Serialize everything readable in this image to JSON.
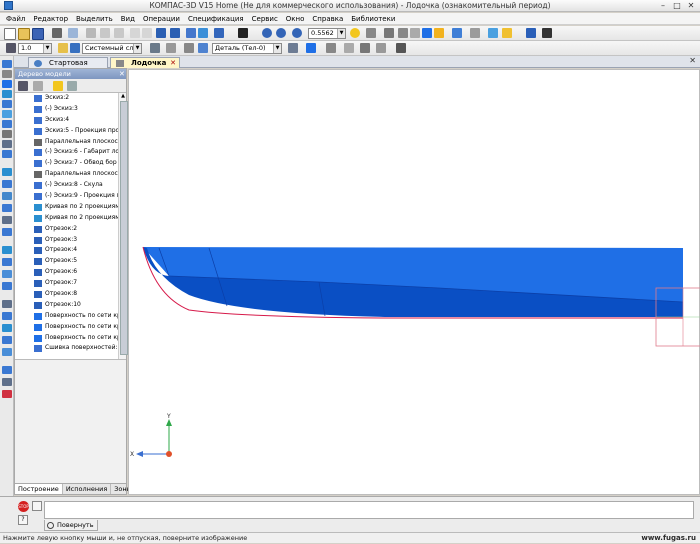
{
  "window": {
    "title": "КОМПАС-3D V15 Home (Не для коммерческого использования) - Лодочка (ознакомительный период)"
  },
  "menu": [
    "Файл",
    "Редактор",
    "Выделить",
    "Вид",
    "Операции",
    "Спецификация",
    "Сервис",
    "Окно",
    "Справка",
    "Библиотеки"
  ],
  "toolbar": {
    "zoom_value": "0.5562",
    "line_width": "1.0",
    "layer": "Системный слой (0)",
    "detail": "Деталь (Тел-0)"
  },
  "tabs": [
    {
      "label": "Стартовая страница",
      "active": false
    },
    {
      "label": "Лодочка",
      "active": true
    }
  ],
  "tree": {
    "header": "Дерево модели",
    "items": [
      {
        "label": "Эскиз:2",
        "icon": "sketch"
      },
      {
        "label": "(-) Эскиз:3",
        "icon": "sketch"
      },
      {
        "label": "Эскиз:4",
        "icon": "sketch"
      },
      {
        "label": "Эскиз:5 - Проекция про",
        "icon": "sketch"
      },
      {
        "label": "Параллельная плоскост",
        "icon": "plane"
      },
      {
        "label": "(-) Эскиз:6 - Габарит ло",
        "icon": "sketch"
      },
      {
        "label": "(-) Эскиз:7 - Обвод бор",
        "icon": "sketch"
      },
      {
        "label": "Параллельная плоскост",
        "icon": "plane"
      },
      {
        "label": "(-) Эскиз:8 - Скула",
        "icon": "sketch"
      },
      {
        "label": "(-) Эскиз:9 - Проекция г",
        "icon": "sketch"
      },
      {
        "label": "Кривая по 2 проекциям",
        "icon": "curve"
      },
      {
        "label": "Кривая по 2 проекциям",
        "icon": "curve"
      },
      {
        "label": "Отрезок:2",
        "icon": "segment"
      },
      {
        "label": "Отрезок:3",
        "icon": "segment"
      },
      {
        "label": "Отрезок:4",
        "icon": "segment"
      },
      {
        "label": "Отрезок:5",
        "icon": "segment"
      },
      {
        "label": "Отрезок:6",
        "icon": "segment"
      },
      {
        "label": "Отрезок:7",
        "icon": "segment"
      },
      {
        "label": "Отрезок:8",
        "icon": "segment"
      },
      {
        "label": "Отрезок:10",
        "icon": "segment"
      },
      {
        "label": "Поверхность по сети кр",
        "icon": "surface"
      },
      {
        "label": "Поверхность по сети кр",
        "icon": "surface"
      },
      {
        "label": "Поверхность по сети кр",
        "icon": "surface"
      },
      {
        "label": "Сшивка поверхностей:1",
        "icon": "stitch"
      }
    ],
    "bottom_tabs": [
      "Построение",
      "Исполнения",
      "Зоны"
    ]
  },
  "axes": {
    "y": "Y",
    "x": "X"
  },
  "propbar": {
    "rotate_label": "Повернуть"
  },
  "status": {
    "text": "Нажмите левую кнопку мыши и, не отпуская, поверните изображение",
    "watermark": "www.fugas.ru"
  },
  "colors": {
    "hull_top": "#1f6fe6",
    "hull_side": "#0a4fc4",
    "hull_edge": "#d61a4a",
    "hull_dark": "#0b3fa8"
  }
}
